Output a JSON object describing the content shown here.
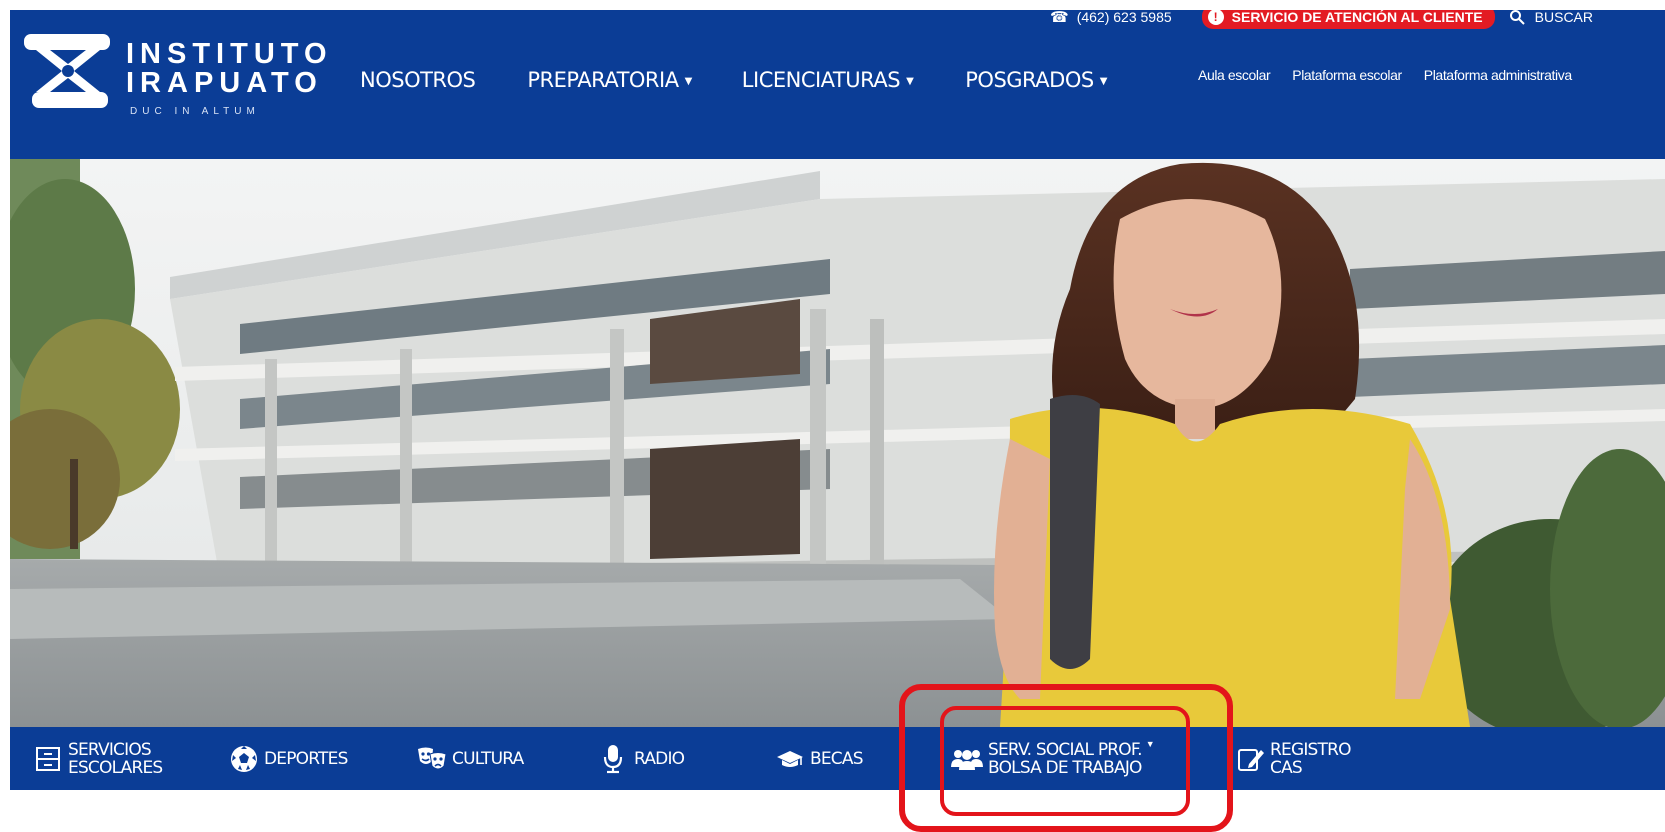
{
  "brand": {
    "name_line1": "INSTITUTO",
    "name_line2": "IRAPUATO",
    "motto": "DUC IN ALTUM"
  },
  "nav": {
    "items": [
      {
        "label": "NOSOTROS"
      },
      {
        "label": "PREPARATORIA"
      },
      {
        "label": "LICENCIATURAS"
      },
      {
        "label": "POSGRADOS"
      }
    ]
  },
  "topbar": {
    "phone": "(462) 623 5985",
    "service": "SERVICIO DE ATENCIÓN AL CLIENTE",
    "search": "BUSCAR"
  },
  "quicklinks": [
    "Aula escolar",
    "Plataforma escolar",
    "Plataforma administrativa"
  ],
  "bottombar": {
    "servicios_line1": "SERVICIOS",
    "servicios_line2": "ESCOLARES",
    "deportes": "DEPORTES",
    "cultura": "CULTURA",
    "radio": "RADIO",
    "becas": "BECAS",
    "serv_line1": "SERV. SOCIAL PROF.",
    "serv_line2": "BOLSA DE TRABAJO",
    "registro_line1": "REGISTRO",
    "registro_line2": "CAS"
  },
  "colors": {
    "header_blue": "#0b3d96",
    "highlight_red": "#e3141a",
    "pill_red": "#e31b23",
    "shirt_yellow": "#e8c93a"
  },
  "icons": [
    "phone-icon",
    "exclamation-icon",
    "search-icon",
    "chevron-down-icon",
    "files-icon",
    "soccer-ball-icon",
    "theater-masks-icon",
    "microphone-icon",
    "graduation-cap-icon",
    "users-icon",
    "edit-icon"
  ]
}
